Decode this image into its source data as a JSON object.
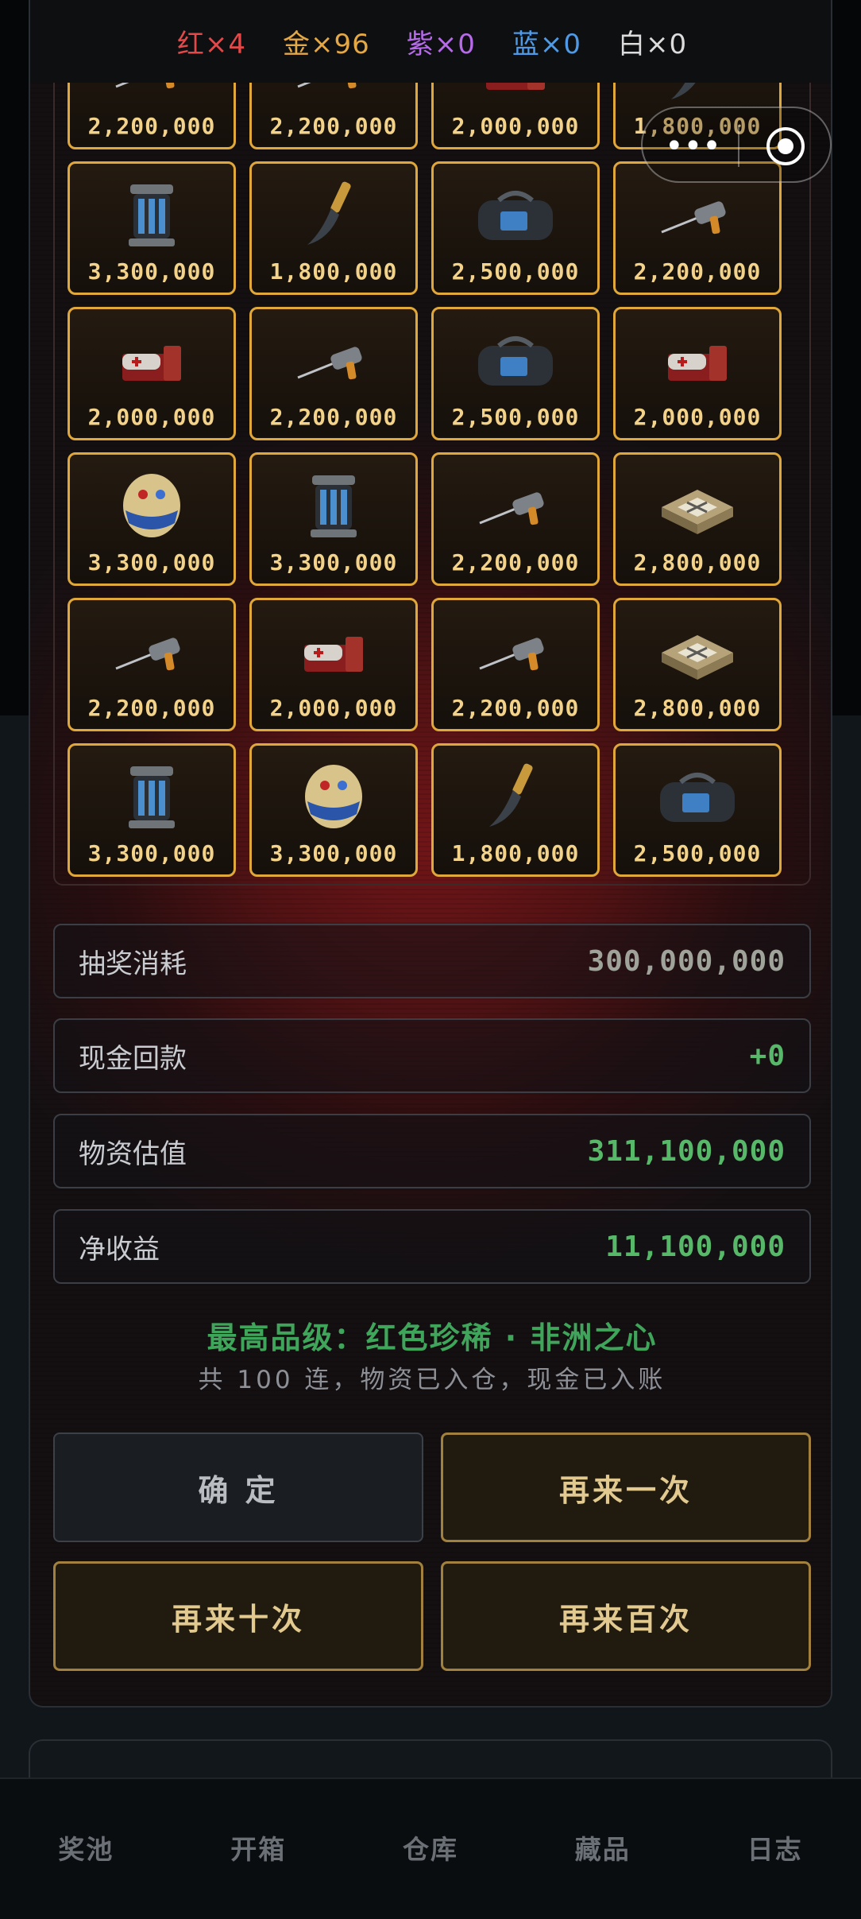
{
  "counts": [
    {
      "label": "红×4",
      "color": "#e44848"
    },
    {
      "label": "金×96",
      "color": "#e4a845"
    },
    {
      "label": "紫×0",
      "color": "#b66be8"
    },
    {
      "label": "蓝×0",
      "color": "#4f9ae6"
    },
    {
      "label": "白×0",
      "color": "#dcdcdc"
    }
  ],
  "grid_items": [
    {
      "price": "2,200,000",
      "icon": "drill-icon"
    },
    {
      "price": "2,200,000",
      "icon": "drill-icon"
    },
    {
      "price": "2,000,000",
      "icon": "medkit-icon"
    },
    {
      "price": "1,800,000",
      "icon": "knife-icon"
    },
    {
      "price": "3,300,000",
      "icon": "reactor-icon"
    },
    {
      "price": "1,800,000",
      "icon": "knife-icon"
    },
    {
      "price": "2,500,000",
      "icon": "duffel-bag-icon"
    },
    {
      "price": "2,200,000",
      "icon": "drill-icon"
    },
    {
      "price": "2,000,000",
      "icon": "medkit-icon"
    },
    {
      "price": "2,200,000",
      "icon": "drill-icon"
    },
    {
      "price": "2,500,000",
      "icon": "duffel-bag-icon"
    },
    {
      "price": "2,000,000",
      "icon": "medkit-icon"
    },
    {
      "price": "3,300,000",
      "icon": "jeweled-egg-icon"
    },
    {
      "price": "3,300,000",
      "icon": "reactor-icon"
    },
    {
      "price": "2,200,000",
      "icon": "drill-icon"
    },
    {
      "price": "2,800,000",
      "icon": "chessboard-icon"
    },
    {
      "price": "2,200,000",
      "icon": "drill-icon"
    },
    {
      "price": "2,000,000",
      "icon": "medkit-icon"
    },
    {
      "price": "2,200,000",
      "icon": "drill-icon"
    },
    {
      "price": "2,800,000",
      "icon": "chessboard-icon"
    },
    {
      "price": "3,300,000",
      "icon": "reactor-icon"
    },
    {
      "price": "3,300,000",
      "icon": "jeweled-egg-icon"
    },
    {
      "price": "1,800,000",
      "icon": "knife-icon"
    },
    {
      "price": "2,500,000",
      "icon": "duffel-bag-icon"
    }
  ],
  "stats": [
    {
      "label": "抽奖消耗",
      "value": "300,000,000"
    },
    {
      "label": "现金回款",
      "value": "+0"
    },
    {
      "label": "物资估值",
      "value": "311,100,000"
    },
    {
      "label": "净收益",
      "value": "11,100,000"
    }
  ],
  "summary": {
    "highest": "最高品级：红色珍稀 · 非洲之心",
    "note": "共 100 连，物资已入仓，现金已入账"
  },
  "buttons": {
    "confirm": "确 定",
    "again_one": "再来一次",
    "again_ten": "再来十次",
    "again_hundred": "再来百次"
  },
  "tabs": [
    "奖池",
    "开箱",
    "仓库",
    "藏品",
    "日志"
  ],
  "colors": {
    "gold_border": "#e0a83a",
    "profit_green": "#57b86a"
  }
}
